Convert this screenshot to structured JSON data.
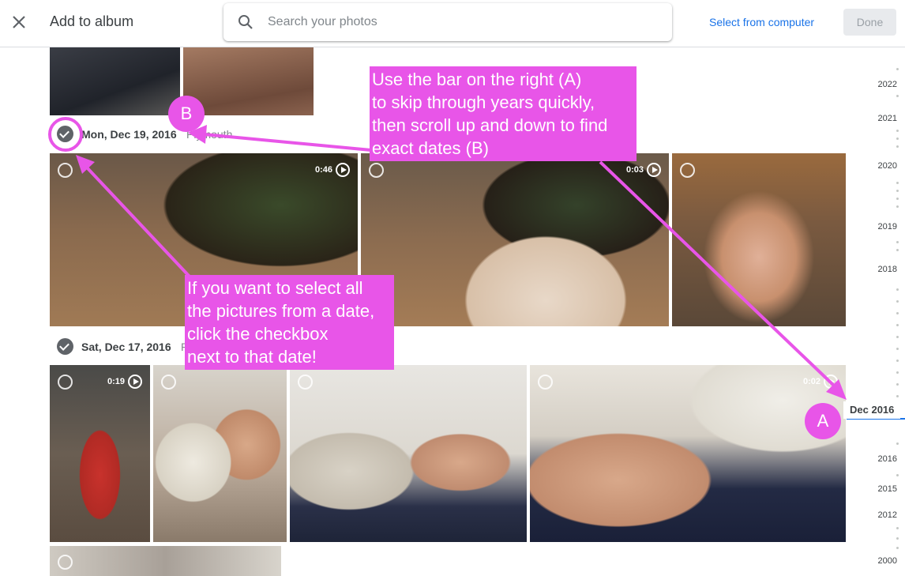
{
  "header": {
    "title": "Add to album",
    "search_placeholder": "Search your photos",
    "select_from_computer": "Select from computer",
    "done_label": "Done"
  },
  "groups": [
    {
      "date": "Mon, Dec 19, 2016",
      "location": "Plymouth"
    },
    {
      "date": "Sat, Dec 17, 2016",
      "location": "P"
    }
  ],
  "durations": {
    "v1": "0:46",
    "v2": "0:03",
    "v3": "0:19",
    "v4": "0:02"
  },
  "timeline": {
    "years": [
      "2022",
      "2021",
      "2020",
      "2019",
      "2018",
      "2016",
      "2015",
      "2012",
      "2000"
    ],
    "current": "Dec 2016"
  },
  "annotations": {
    "note_a": [
      "Use the bar on the right (A)",
      "to skip through years quickly,",
      "then scroll up and down to find",
      "exact dates (B)"
    ],
    "note_b": [
      "If you want to select all",
      "the pictures from a date,",
      "click the checkbox",
      "next to that date!"
    ],
    "badge_a": "A",
    "badge_b": "B"
  },
  "colors": {
    "annotation": "#e855e8",
    "accent": "#1a73e8"
  }
}
